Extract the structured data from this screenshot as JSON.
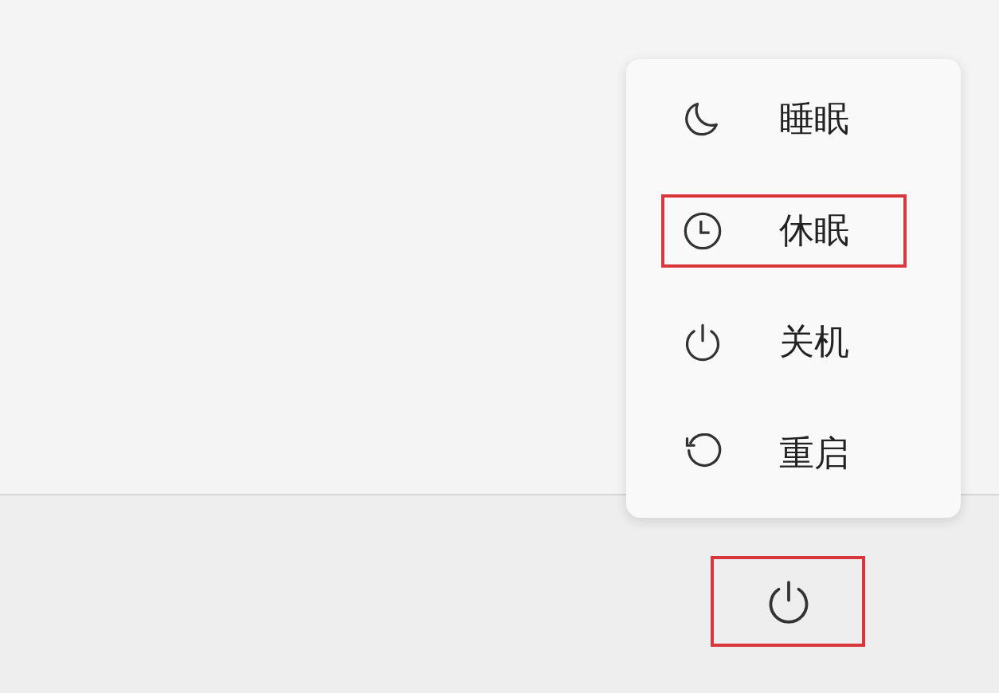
{
  "power_menu": {
    "items": [
      {
        "kind": "sleep",
        "label": "睡眠",
        "highlighted": false
      },
      {
        "kind": "hibernate",
        "label": "休眠",
        "highlighted": true
      },
      {
        "kind": "shutdown",
        "label": "关机",
        "highlighted": false
      },
      {
        "kind": "restart",
        "label": "重启",
        "highlighted": false
      }
    ]
  },
  "taskbar": {
    "power_button": {
      "highlighted": true
    }
  }
}
